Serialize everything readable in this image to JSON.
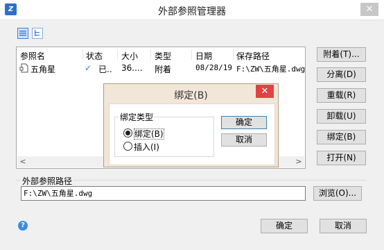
{
  "window": {
    "title": "外部参照管理器",
    "close": "✕"
  },
  "list": {
    "columns": [
      "参照名",
      "状态",
      "大小",
      "类型",
      "日期",
      "保存路径"
    ],
    "rows": [
      {
        "name": "五角星",
        "status": "已..",
        "size": "36....",
        "type": "附着",
        "date": "08/28/19",
        "path": "F:\\ZW\\五角星.dwg"
      }
    ],
    "scroll_left": "<",
    "scroll_right": ">"
  },
  "side_buttons": [
    "附着(T)...",
    "分离(D)",
    "重载(R)",
    "卸载(U)",
    "绑定(B)",
    "打开(N)"
  ],
  "path_group": {
    "label": "外部参照路径",
    "value": "F:\\ZW\\五角星.dwg",
    "browse": "浏览(O)..."
  },
  "help": "?",
  "footer": {
    "ok": "确定",
    "cancel": "取消"
  },
  "modal": {
    "title": "绑定(B)",
    "close": "✕",
    "group_label": "绑定类型",
    "options": [
      "绑定(B)",
      "插入(I)"
    ],
    "selected": "绑定(B)",
    "ok": "确定",
    "cancel": "取消"
  },
  "colors": {
    "modal_bg": "#f2e6d8",
    "modal_close": "#e04343",
    "accent": "#3c8de0"
  }
}
